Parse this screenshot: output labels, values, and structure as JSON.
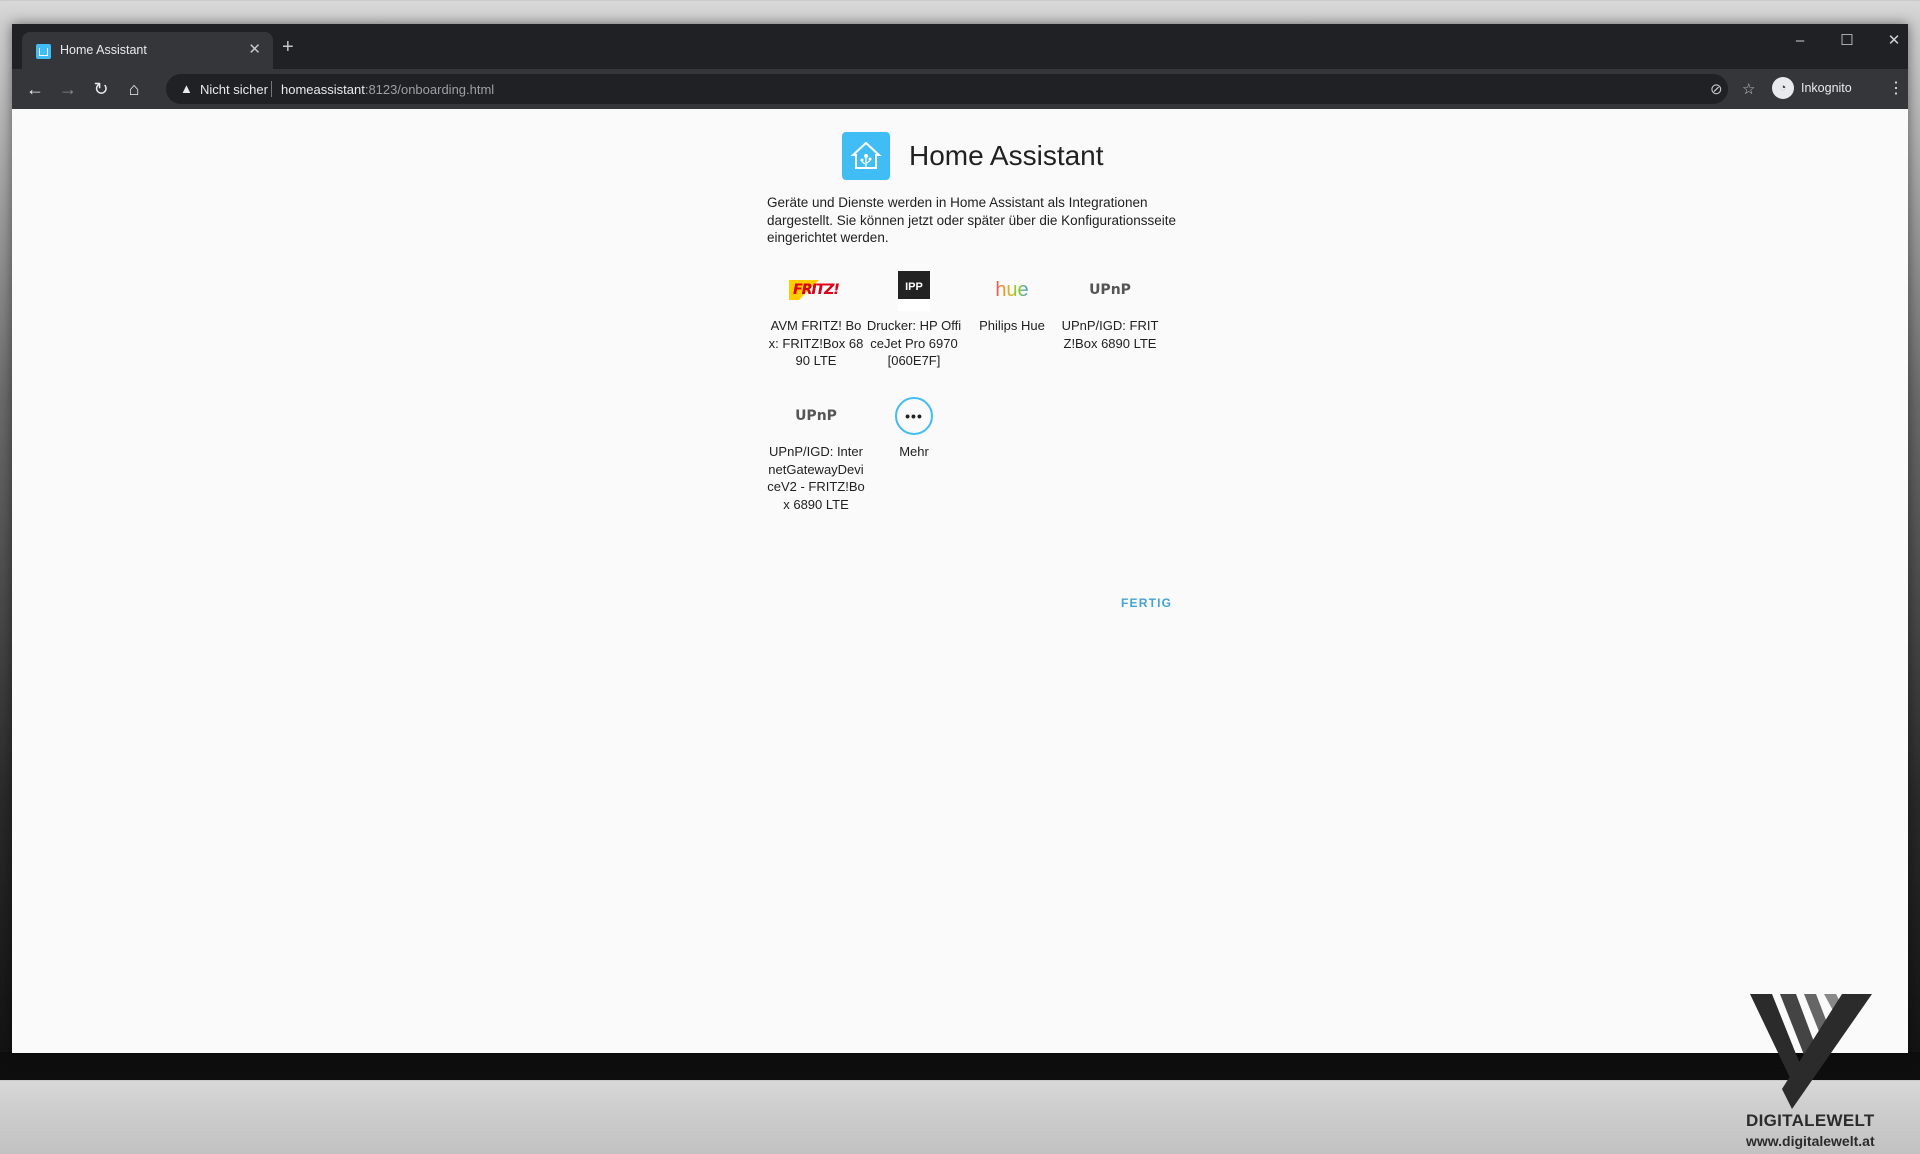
{
  "browser": {
    "tab_title": "Home Assistant",
    "tab_close": "✕",
    "new_tab": "+",
    "window_controls": {
      "minimize": "–",
      "maximize": "☐",
      "close": "✕"
    },
    "security_label": "Nicht sicher",
    "url_host": "homeassistant",
    "url_rest": ":8123/onboarding.html",
    "profile_label": "Inkognito"
  },
  "page": {
    "brand": "Home Assistant",
    "intro": "Geräte und Dienste werden in Home Assistant als Integrationen dargestellt. Sie können jetzt oder später über die Konfigurationsseite eingerichtet werden.",
    "integrations": [
      {
        "id": "fritz",
        "logo_text": "FRITZ!",
        "label": "AVM FRITZ! Box: FRITZ!Box 6890 LTE"
      },
      {
        "id": "ipp",
        "logo_text": "IPP",
        "label": "Drucker: HP OfficeJet Pro 6970 [060E7F]"
      },
      {
        "id": "hue",
        "logo_text": "hue",
        "label": "Philips Hue"
      },
      {
        "id": "upnp1",
        "logo_text": "UPnP",
        "label": "UPnP/IGD: FRITZ!Box 6890 LTE"
      },
      {
        "id": "upnp2",
        "logo_text": "UPnP",
        "label": "UPnP/IGD: InternetGatewayDeviceV2 - FRITZ!Box 6890 LTE"
      },
      {
        "id": "more",
        "logo_text": "•••",
        "label": "Mehr"
      }
    ],
    "finish_button": "FERTIG"
  },
  "watermark": {
    "name": "DIGITALEWELT",
    "url": "www.digitalewelt.at"
  },
  "colors": {
    "accent": "#41bdf5",
    "link": "#41a3d6",
    "chrome_dark": "#202124",
    "chrome_toolbar": "#35363a"
  }
}
